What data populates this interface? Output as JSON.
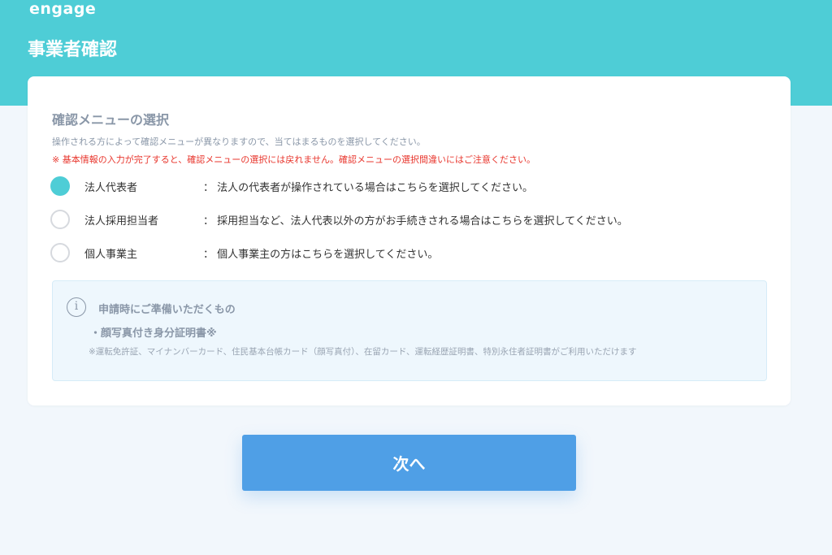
{
  "header": {
    "logo": "engage",
    "title": "事業者確認"
  },
  "selection": {
    "title": "確認メニューの選択",
    "description": "操作される方によって確認メニューが異なりますので、当てはまるものを選択してください。",
    "warning": "※ 基本情報の入力が完了すると、確認メニューの選択には戻れません。確認メニューの選択間違いにはご注意ください。",
    "options": [
      {
        "label": "法人代表者",
        "description": "：  法人の代表者が操作されている場合はこちらを選択してください。",
        "selected": true
      },
      {
        "label": "法人採用担当者",
        "description": "：  採用担当など、法人代表以外の方がお手続きされる場合はこちらを選択してください。",
        "selected": false
      },
      {
        "label": "個人事業主",
        "description": "：  個人事業主の方はこちらを選択してください。",
        "selected": false
      }
    ]
  },
  "info": {
    "icon_glyph": "i",
    "title": "申請時にご準備いただくもの",
    "item": "・顔写真付き身分証明書※",
    "note": "※運転免許証、マイナンバーカード、住民基本台帳カード（顔写真付）、在留カード、運転経歴証明書、特別永住者証明書がご利用いただけます"
  },
  "footer": {
    "next_label": "次へ"
  },
  "colors": {
    "accent": "#4ecdd6",
    "button": "#4f9fe6",
    "warning": "#e8352c"
  }
}
